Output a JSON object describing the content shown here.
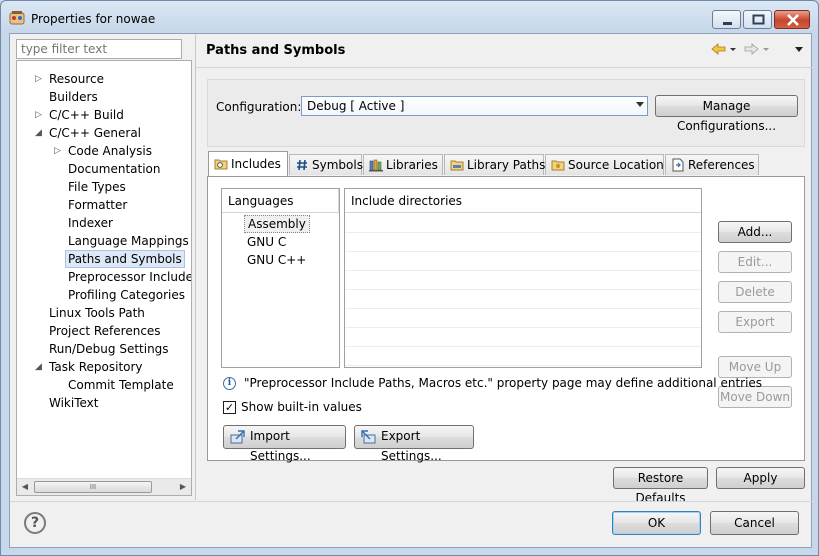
{
  "window": {
    "title": "Properties for nowae"
  },
  "sidebar": {
    "filter_placeholder": "type filter text",
    "items": [
      {
        "label": "Resource",
        "level": 1,
        "twisty": "collapsed"
      },
      {
        "label": "Builders",
        "level": 1,
        "twisty": ""
      },
      {
        "label": "C/C++ Build",
        "level": 1,
        "twisty": "collapsed"
      },
      {
        "label": "C/C++ General",
        "level": 1,
        "twisty": "expanded"
      },
      {
        "label": "Code Analysis",
        "level": 2,
        "twisty": "collapsed"
      },
      {
        "label": "Documentation",
        "level": 2,
        "twisty": ""
      },
      {
        "label": "File Types",
        "level": 2,
        "twisty": ""
      },
      {
        "label": "Formatter",
        "level": 2,
        "twisty": ""
      },
      {
        "label": "Indexer",
        "level": 2,
        "twisty": ""
      },
      {
        "label": "Language Mappings",
        "level": 2,
        "twisty": ""
      },
      {
        "label": "Paths and Symbols",
        "level": 2,
        "twisty": "",
        "selected": true
      },
      {
        "label": "Preprocessor Include Pa",
        "level": 2,
        "twisty": ""
      },
      {
        "label": "Profiling Categories",
        "level": 2,
        "twisty": ""
      },
      {
        "label": "Linux Tools Path",
        "level": 1,
        "twisty": ""
      },
      {
        "label": "Project References",
        "level": 1,
        "twisty": ""
      },
      {
        "label": "Run/Debug Settings",
        "level": 1,
        "twisty": ""
      },
      {
        "label": "Task Repository",
        "level": 1,
        "twisty": "expanded"
      },
      {
        "label": "Commit Template",
        "level": 2,
        "twisty": ""
      },
      {
        "label": "WikiText",
        "level": 1,
        "twisty": ""
      }
    ],
    "scroll_thumb_grip": "III"
  },
  "header": {
    "title": "Paths and Symbols"
  },
  "configuration": {
    "label": "Configuration:",
    "selected": "Debug  [ Active ]",
    "manage_label": "Manage Configurations..."
  },
  "tabs": [
    {
      "label": "Includes",
      "icon": "includes-icon",
      "active": true
    },
    {
      "label": "Symbols",
      "icon": "hash-icon"
    },
    {
      "label": "Libraries",
      "icon": "libraries-icon"
    },
    {
      "label": "Library Paths",
      "icon": "folder-icon"
    },
    {
      "label": "Source Location",
      "icon": "folder-icon"
    },
    {
      "label": "References",
      "icon": "references-icon"
    }
  ],
  "includes": {
    "languages_header": "Languages",
    "directories_header": "Include directories",
    "languages": [
      "Assembly",
      "GNU C",
      "GNU C++"
    ],
    "selected_language": "Assembly",
    "buttons": {
      "add": "Add...",
      "edit": "Edit...",
      "delete": "Delete",
      "export": "Export",
      "move_up": "Move Up",
      "move_down": "Move Down"
    },
    "info_text": "\"Preprocessor Include Paths, Macros etc.\" property page may define additional entries",
    "show_builtin_label": "Show built-in values",
    "show_builtin_checked": "✓",
    "import_label": "Import Settings...",
    "export_settings_label": "Export Settings..."
  },
  "footer": {
    "restore_defaults": "Restore Defaults",
    "apply": "Apply",
    "ok": "OK",
    "cancel": "Cancel",
    "help_symbol": "?"
  }
}
